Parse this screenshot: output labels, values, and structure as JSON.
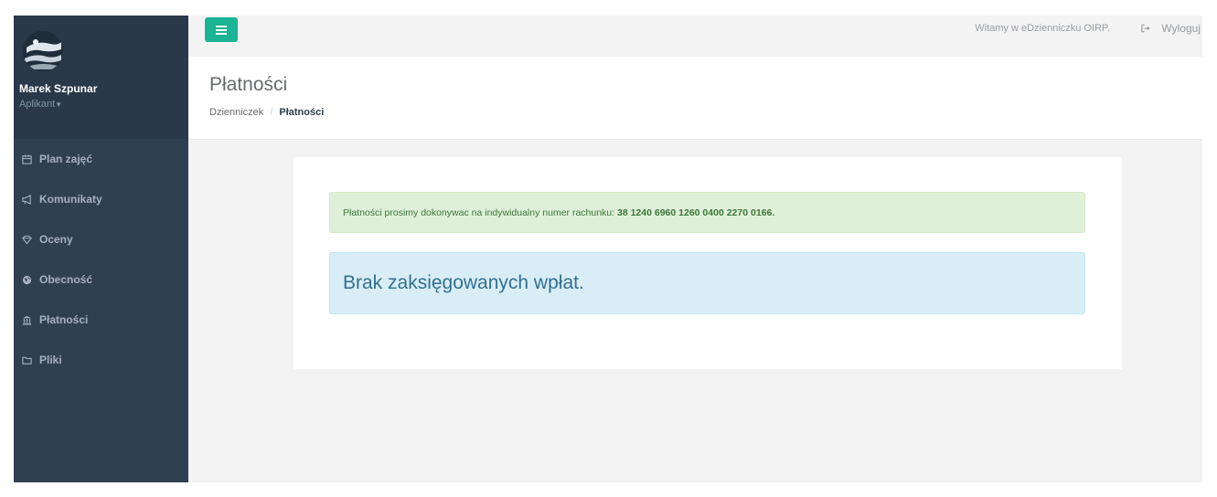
{
  "sidebar": {
    "user_name": "Marek Szpunar",
    "user_role": "Aplikant",
    "items": [
      {
        "label": "Plan zajęć",
        "icon": "calendar-icon"
      },
      {
        "label": "Komunikaty",
        "icon": "bullhorn-icon"
      },
      {
        "label": "Oceny",
        "icon": "diamond-icon"
      },
      {
        "label": "Obecność",
        "icon": "globe-icon"
      },
      {
        "label": "Płatności",
        "icon": "bank-icon"
      },
      {
        "label": "Pliki",
        "icon": "folder-icon"
      }
    ]
  },
  "topbar": {
    "welcome_text": "Witamy w eDzienniczku OIRP.",
    "logout_label": "Wyloguj"
  },
  "page": {
    "title": "Płatności",
    "breadcrumb": [
      "Dzienniczek",
      "Płatności"
    ]
  },
  "content": {
    "payment_notice": "Płatności prosimy dokonywac na indywidualny numer rachunku:",
    "account_number": "38 1240 6960 1260 0400 2270 0166.",
    "no_payments": "Brak zaksięgowanych wpłat."
  },
  "colors": {
    "sidebar_bg": "#2f4050",
    "accent": "#1ab394",
    "success_bg": "#dff0d8",
    "info_bg": "#d9edf7"
  }
}
